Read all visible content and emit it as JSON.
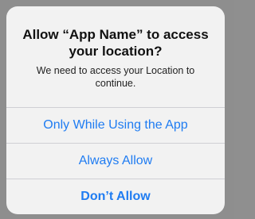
{
  "alert": {
    "title": "Allow “App Name” to access your location?",
    "message": "We need to access your Location to continue.",
    "actions": [
      {
        "label": "Only While Using the App"
      },
      {
        "label": "Always Allow"
      },
      {
        "label": "Don’t Allow"
      }
    ]
  },
  "colors": {
    "backdrop": "#8e8e8e",
    "alert_background": "#f2f2f2",
    "action_text": "#1f7cf2",
    "title_text": "#111111"
  }
}
